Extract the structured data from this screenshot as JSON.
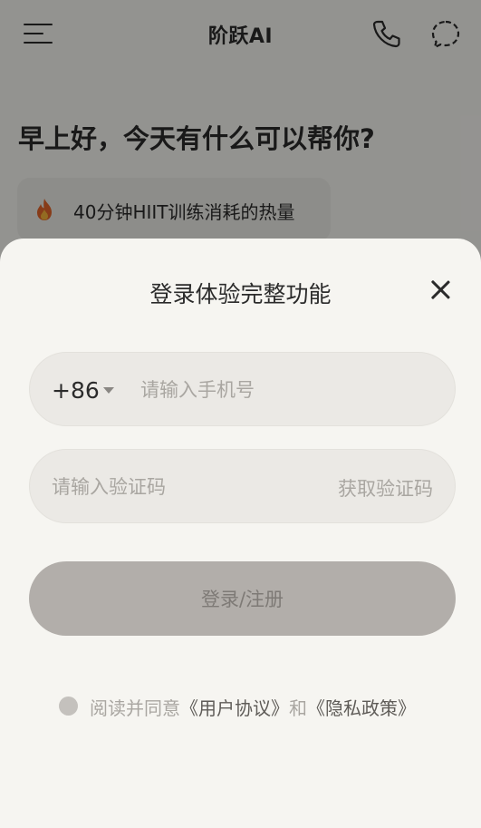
{
  "app": {
    "title": "阶跃AI",
    "greeting": "早上好，今天有什么可以帮你?",
    "suggestion": "40分钟HIIT训练消耗的热量"
  },
  "login": {
    "title": "登录体验完整功能",
    "country_code": "+86",
    "phone_placeholder": "请输入手机号",
    "code_placeholder": "请输入验证码",
    "get_code_label": "获取验证码",
    "login_label": "登录/注册",
    "agreement": {
      "prefix": "阅读并同意",
      "terms": "《用户协议》",
      "and": "和",
      "privacy": "《隐私政策》"
    }
  },
  "icons": {
    "menu": "menu-icon",
    "phone": "phone-icon",
    "chat": "chat-icon",
    "fire": "fire-icon",
    "close": "close-icon",
    "dropdown": "caret-down-icon"
  },
  "colors": {
    "sheet_background": "#f6f5f1",
    "field_background": "#ebe9e5",
    "login_button": "#b2aeaa",
    "text_primary": "#2b2b2b",
    "text_placeholder": "#a9a6a1"
  }
}
